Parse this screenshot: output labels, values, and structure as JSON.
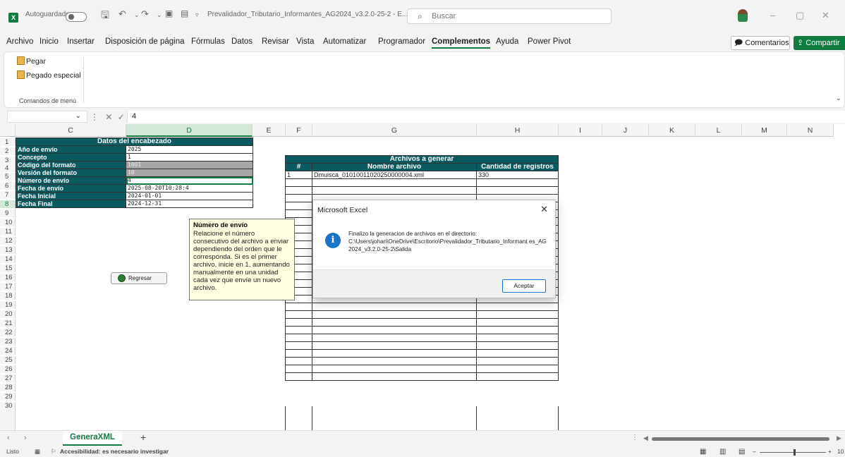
{
  "titlebar": {
    "autosave_label": "Autoguardado",
    "filename": "Prevalidador_Tributario_Informantes_AG2024_v3.2.0-25-2  -  E...",
    "search_placeholder": "Buscar"
  },
  "menu": {
    "tabs": [
      "Archivo",
      "Inicio",
      "Insertar",
      "Disposición de página",
      "Fórmulas",
      "Datos",
      "Revisar",
      "Vista",
      "Automatizar",
      "Programador",
      "Complementos",
      "Ayuda",
      "Power Pivot"
    ],
    "active_tab": "Complementos",
    "comments_label": "Comentarios",
    "share_label": "Compartir"
  },
  "ribbon": {
    "paste_label": "Pegar",
    "paste_special_label": "Pegado especial",
    "group_label": "Comandos de menú"
  },
  "formula_bar": {
    "value": "4"
  },
  "columns": [
    "C",
    "D",
    "E",
    "F",
    "G",
    "H",
    "I",
    "J",
    "K",
    "L",
    "M",
    "N"
  ],
  "rows": [
    "1",
    "2",
    "3",
    "4",
    "5",
    "6",
    "7",
    "8",
    "9",
    "10",
    "11",
    "12",
    "13",
    "14",
    "15",
    "16",
    "17",
    "18",
    "19",
    "20",
    "21",
    "22",
    "23",
    "24",
    "25",
    "26",
    "27",
    "28",
    "29",
    "30"
  ],
  "header_table": {
    "title": "Datos del encabezado",
    "rows": [
      {
        "label": "Año de envío",
        "value": "2025"
      },
      {
        "label": "Concepto",
        "value": "1"
      },
      {
        "label": "Código del formato",
        "value": "1001"
      },
      {
        "label": "Versión del formato",
        "value": "10"
      },
      {
        "label": "Número de envío",
        "value": "4"
      },
      {
        "label": "Fecha de envío",
        "value": "2025-08-20T10:28:4"
      },
      {
        "label": "Fecha Inicial",
        "value": "2024-01-01"
      },
      {
        "label": "Fecha Final",
        "value": "2024-12-31"
      }
    ]
  },
  "files_table": {
    "title": "Archivos a generar",
    "col_num": "#",
    "col_name": "Nombre archivo",
    "col_count": "Cantidad de registros",
    "rows": [
      {
        "num": "1",
        "name": "Dmuisca_01010011020250000004.xml",
        "count": "330"
      }
    ]
  },
  "regresar_label": "Regresar",
  "tooltip": {
    "title": "Número de envío",
    "body": "Relacione el número consecutivo del archivo a enviar dependiendo del orden que le corresponda. Si es el primer archivo, inicie en 1, aumentando manualmente en una unidad cada vez que envíe un nuevo archivo."
  },
  "dialog": {
    "title": "Microsoft Excel",
    "message_line1": "Finalizo la generacion de archivos en el directorio:",
    "message_line2": "C:\\Users\\johan\\OneDrive\\Escritorio\\Prevalidador_Tributario_Informant es_AG2024_v3.2.0-25-2\\Salida",
    "ok_label": "Aceptar"
  },
  "sheet_tab": "GeneraXML",
  "status": {
    "ready": "Listo",
    "accessibility": "Accesibilidad: es necesario investigar",
    "zoom": "10"
  }
}
